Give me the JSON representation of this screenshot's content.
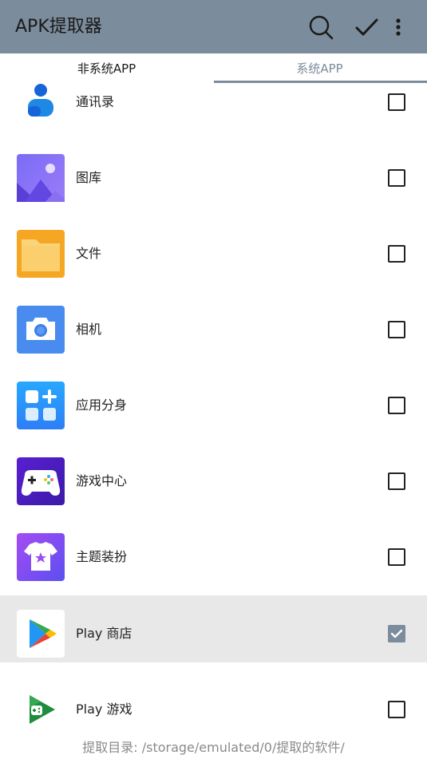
{
  "app": {
    "title": "APK提取器"
  },
  "toolbar": {
    "search_icon": "search-icon",
    "confirm_icon": "check-icon",
    "more_icon": "more-vert-icon"
  },
  "tabs": [
    {
      "label": "非系统APP",
      "active": false
    },
    {
      "label": "系统APP",
      "active": true
    }
  ],
  "apps": [
    {
      "name": "通讯录",
      "icon": "contacts-icon",
      "checked": false
    },
    {
      "name": "图库",
      "icon": "gallery-icon",
      "checked": false
    },
    {
      "name": "文件",
      "icon": "files-icon",
      "checked": false
    },
    {
      "name": "相机",
      "icon": "camera-icon",
      "checked": false
    },
    {
      "name": "应用分身",
      "icon": "app-clone-icon",
      "checked": false
    },
    {
      "name": "游戏中心",
      "icon": "game-center-icon",
      "checked": false
    },
    {
      "name": "主题装扮",
      "icon": "themes-icon",
      "checked": false
    },
    {
      "name": "Play 商店",
      "icon": "play-store-icon",
      "checked": true
    },
    {
      "name": "Play 游戏",
      "icon": "play-games-icon",
      "checked": false
    }
  ],
  "footer": {
    "text": "提取目录: /storage/emulated/0/提取的软件/"
  },
  "colors": {
    "appbar": "#7b8c9c",
    "selected_row": "#e8e8e8",
    "checkbox_checked": "#7b8c9c"
  }
}
